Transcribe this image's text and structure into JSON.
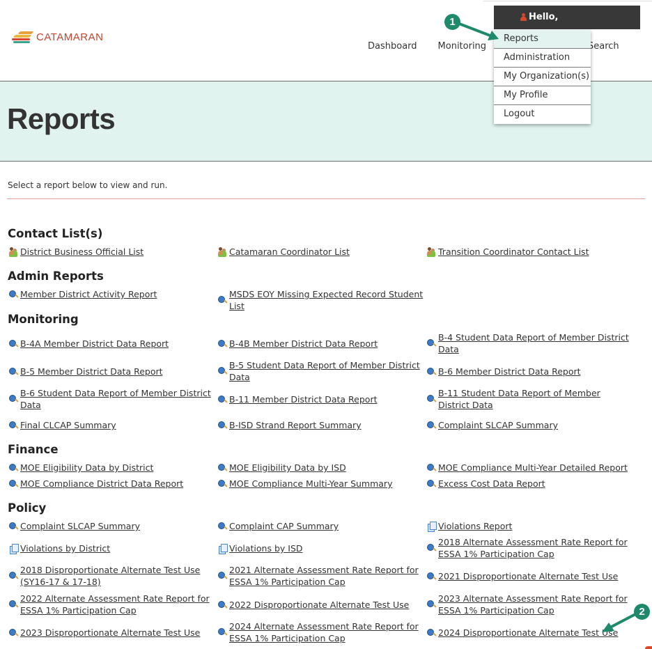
{
  "brand": {
    "name": "CATAMARAN",
    "colors": {
      "logo_text": "#c9422b",
      "accent_teal": "#1f8a6b",
      "title_band": "#e1f3ef",
      "user_bar": "#383838"
    }
  },
  "nav": {
    "items": [
      "Dashboard",
      "Monitoring",
      "Search"
    ]
  },
  "user_menu": {
    "greeting": "Hello,",
    "icon": "user-icon",
    "items": [
      {
        "label": "Reports",
        "active": true
      },
      {
        "label": "Administration",
        "active": false
      },
      {
        "label": "My Organization(s)",
        "active": false
      },
      {
        "label": "My Profile",
        "active": false
      },
      {
        "label": "Logout",
        "active": false
      }
    ]
  },
  "page": {
    "title": "Reports",
    "intro": "Select a report below to view and run."
  },
  "sections": [
    {
      "title": "Contact List(s)",
      "items": [
        {
          "label": "District Business Official List",
          "icon": "people-icon"
        },
        {
          "label": "Catamaran Coordinator List",
          "icon": "people-icon"
        },
        {
          "label": "Transition Coordinator Contact List",
          "icon": "people-icon"
        }
      ]
    },
    {
      "title": "Admin Reports",
      "items": [
        {
          "label": "Member District Activity Report",
          "icon": "search-icon"
        },
        {
          "label": "MSDS EOY Missing Expected Record Student List",
          "icon": "search-icon"
        }
      ]
    },
    {
      "title": "Monitoring",
      "items": [
        {
          "label": "B-4A Member District Data Report",
          "icon": "search-icon"
        },
        {
          "label": "B-4B Member District Data Report",
          "icon": "search-icon"
        },
        {
          "label": "B-4 Student Data Report of Member District Data",
          "icon": "search-icon"
        },
        {
          "label": "B-5 Member District Data Report",
          "icon": "search-icon"
        },
        {
          "label": "B-5 Student Data Report of Member District Data",
          "icon": "search-icon"
        },
        {
          "label": "B-6 Member District Data Report",
          "icon": "search-icon"
        },
        {
          "label": "B-6 Student Data Report of Member District Data",
          "icon": "search-icon"
        },
        {
          "label": "B-11 Member District Data Report",
          "icon": "search-icon"
        },
        {
          "label": "B-11 Student Data Report of Member District Data",
          "icon": "search-icon"
        },
        {
          "label": "Final CLCAP Summary",
          "icon": "search-icon"
        },
        {
          "label": "B-ISD Strand Report Summary",
          "icon": "search-icon"
        },
        {
          "label": "Complaint SLCAP Summary",
          "icon": "search-icon"
        }
      ]
    },
    {
      "title": "Finance",
      "items": [
        {
          "label": "MOE Eligibility Data by District",
          "icon": "search-icon"
        },
        {
          "label": "MOE Eligibility Data by ISD",
          "icon": "search-icon"
        },
        {
          "label": "MOE Compliance Multi-Year Detailed Report",
          "icon": "search-icon"
        },
        {
          "label": "MOE Compliance District Data Report",
          "icon": "search-icon"
        },
        {
          "label": "MOE Compliance Multi-Year Summary",
          "icon": "search-icon"
        },
        {
          "label": "Excess Cost Data Report",
          "icon": "search-icon"
        }
      ]
    },
    {
      "title": "Policy",
      "items": [
        {
          "label": "Complaint SLCAP Summary",
          "icon": "search-icon"
        },
        {
          "label": "Complaint CAP Summary",
          "icon": "search-icon"
        },
        {
          "label": "Violations Report",
          "icon": "document-icon"
        },
        {
          "label": "Violations by District",
          "icon": "document-icon"
        },
        {
          "label": "Violations by ISD",
          "icon": "document-icon"
        },
        {
          "label": "2018 Alternate Assessment Rate Report for ESSA 1% Participation Cap",
          "icon": "search-icon"
        },
        {
          "label": "2018 Disproportionate Alternate Test Use (SY16-17 & 17-18)",
          "icon": "search-icon"
        },
        {
          "label": "2021 Alternate Assessment Rate Report for ESSA 1% Participation Cap",
          "icon": "search-icon"
        },
        {
          "label": "2021 Disproportionate Alternate Test Use",
          "icon": "search-icon"
        },
        {
          "label": "2022 Alternate Assessment Rate Report for ESSA 1% Participation Cap",
          "icon": "search-icon"
        },
        {
          "label": "2022 Disproportionate Alternate Test Use",
          "icon": "search-icon"
        },
        {
          "label": "2023 Alternate Assessment Rate Report for ESSA 1% Participation Cap",
          "icon": "search-icon"
        },
        {
          "label": "2023 Disproportionate Alternate Test Use",
          "icon": "search-icon"
        },
        {
          "label": "2024 Alternate Assessment Rate Report for ESSA 1% Participation Cap",
          "icon": "search-icon"
        },
        {
          "label": "2024 Disproportionate Alternate Test Use",
          "icon": "search-icon"
        }
      ]
    }
  ],
  "annotations": [
    {
      "number": "1",
      "target": "Reports menu item"
    },
    {
      "number": "2",
      "target": "2024 Disproportionate Alternate Test Use"
    }
  ]
}
